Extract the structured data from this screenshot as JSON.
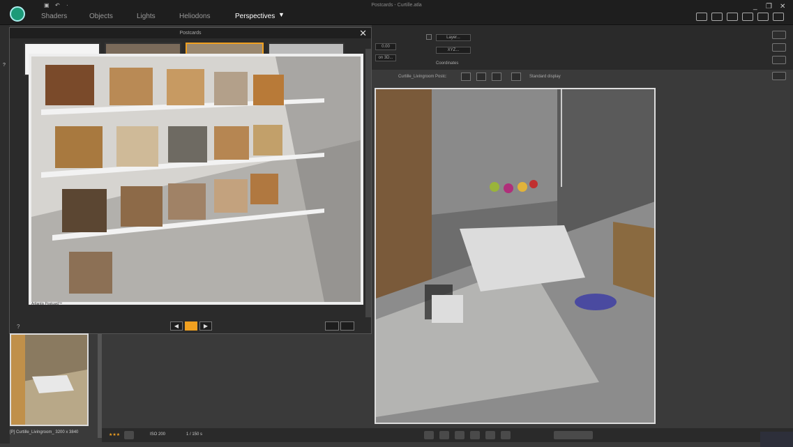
{
  "window": {
    "title": "Postcards - Curtille.atla"
  },
  "top_tabs": [
    "Shaders",
    "Objects",
    "Lights",
    "Heliodons",
    "Perspectives"
  ],
  "perspectives_caret": "▼",
  "window_buttons": [
    "_",
    "❐",
    "✕"
  ],
  "toolbar": {
    "value": "0.00",
    "projection": "on 3D...",
    "layer_placeholder": "Layer...",
    "xyz": "XYZ...",
    "coordinates_label": "Coordinates",
    "perspective_name": "Curtille_Livingroom Postc:",
    "display_mode": "Standard display"
  },
  "postcards_panel": {
    "title": "Postcards",
    "close": "✕",
    "help": "?",
    "caption": "Artlantis Postcard™",
    "nav_prev": "◀",
    "nav_next": "▶"
  },
  "left_help": "?",
  "gallery": {
    "label": "[P] Curtille_Livingroom_ 3200 x 3840"
  },
  "bottombar": {
    "stars": "★★★",
    "iso": "ISO  200",
    "shutter": "1 / 150 s"
  }
}
